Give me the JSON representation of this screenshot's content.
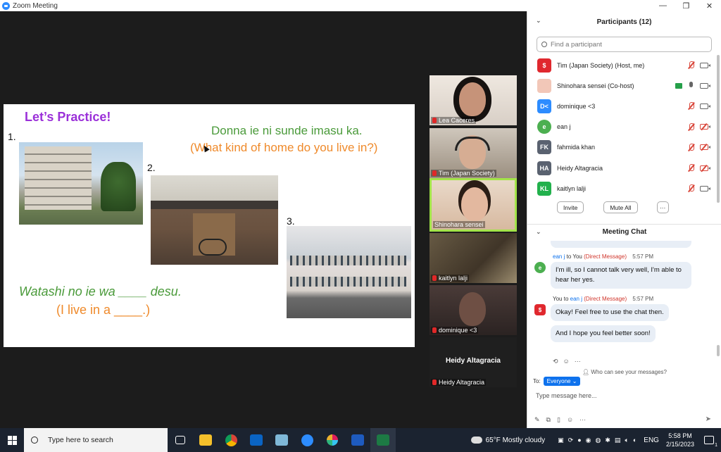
{
  "window": {
    "title": "Zoom Meeting",
    "controls": [
      "—",
      "❐",
      "✕"
    ]
  },
  "slide": {
    "title": "Let’s Practice!",
    "question_jp": "Donna ie ni sunde imasu ka.",
    "question_en": "(What kind of home do you live in?)",
    "answer_jp": "Watashi no ie wa ____ desu.",
    "answer_en": "(I live in a ____.)",
    "numbers": [
      "1.",
      "2.",
      "3."
    ]
  },
  "videos": [
    {
      "name": "Lea Caceres"
    },
    {
      "name": "Tim (Japan Society)"
    },
    {
      "name": "Shinohara sensei"
    },
    {
      "name": "kaitlyn lalji"
    },
    {
      "name": "dominique <3"
    },
    {
      "name": "Heidy Altagracia",
      "display_name": "Heidy Altagracia"
    }
  ],
  "participants": {
    "header": "Participants (12)",
    "search_placeholder": "Find a participant",
    "list": [
      {
        "initials": "",
        "name": "Tim (Japan Society) (Host, me)",
        "color": "#e0282e"
      },
      {
        "initials": "",
        "name": "Shinohara sensei (Co-host)",
        "color": "#f2b8a6"
      },
      {
        "initials": "D<",
        "name": "dominique <3",
        "color": "#2d8cff"
      },
      {
        "initials": "e",
        "name": "ean j",
        "color": "#4caf50"
      },
      {
        "initials": "FK",
        "name": "fahmida khan",
        "color": "#5a6270"
      },
      {
        "initials": "HA",
        "name": "Heidy Altagracia",
        "color": "#5a6270"
      },
      {
        "initials": "KL",
        "name": "kaitlyn lalji",
        "color": "#22b14c"
      }
    ],
    "invite": "Invite",
    "mute_all": "Mute All",
    "more": "···"
  },
  "chat": {
    "header": "Meeting Chat",
    "msg1": {
      "from": "ean j",
      "to_label": "to You",
      "dm": "(Direct Message)",
      "time": "5:57 PM",
      "avatar": "e",
      "text": "I'm ill, so I cannot talk very well, I'm able to hear her yes."
    },
    "msg2": {
      "from": "You",
      "to_word": "to",
      "to_name": "ean j",
      "dm": "(Direct Message)",
      "time": "5:57 PM",
      "text1": "Okay! Feel free to use the chat then.",
      "text2": "And I hope you feel better soon!"
    },
    "who_can_see": "Who can see your messages?",
    "to_label": "To:",
    "to_value": "Everyone",
    "placeholder": "Type message here..."
  },
  "taskbar": {
    "search_placeholder": "Type here to search",
    "weather": "65°F  Mostly cloudy",
    "lang": "ENG",
    "time": "5:58 PM",
    "date": "2/15/2023",
    "notifications": "1"
  }
}
